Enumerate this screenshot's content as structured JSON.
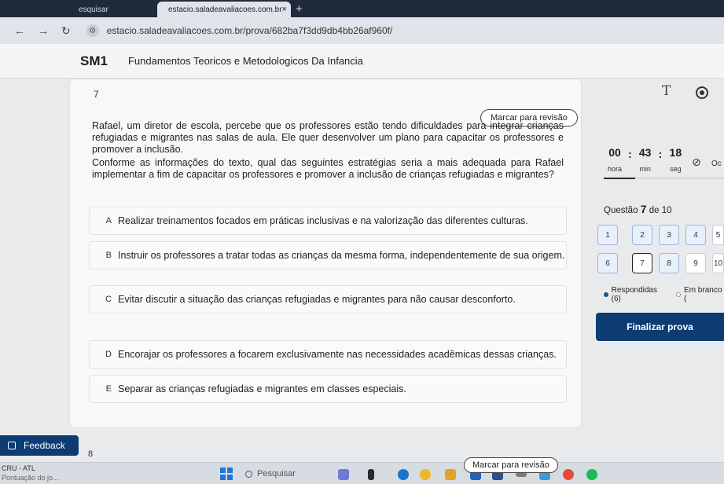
{
  "browser": {
    "tab_prev_label": "esquisar",
    "tab_active_label": "estacio.saladeavaliacoes.com.br",
    "tab_close": "×",
    "new_tab": "+",
    "url": "estacio.saladeavaliacoes.com.br/prova/682ba7f3dd9db4bb26af960f/"
  },
  "header": {
    "logo": "SM1",
    "course_title": "Fundamentos Teoricos e Metodologicos Da Infancia"
  },
  "question": {
    "number": "7",
    "mark_review_label": "Marcar para revisão",
    "stem_paragraphs": [
      "Rafael, um diretor de escola, percebe que os professores estão tendo dificuldades para integrar crianças refugiadas e migrantes nas salas de aula. Ele quer desenvolver um plano para capacitar os professores e promover a inclusão.",
      "Conforme as informações do texto, qual das seguintes estratégias seria a mais adequada para Rafael implementar a fim de capacitar os professores e promover a inclusão de crianças refugiadas e migrantes?"
    ],
    "options": [
      {
        "letter": "A",
        "text": "Realizar treinamentos focados em práticas inclusivas e na valorização das diferentes culturas."
      },
      {
        "letter": "B",
        "text": "Instruir os professores a tratar todas as crianças da mesma forma, independentemente de sua origem."
      },
      {
        "letter": "C",
        "text": "Evitar discutir a situação das crianças refugiadas e migrantes para não causar desconforto."
      },
      {
        "letter": "D",
        "text": "Encorajar os professores a focarem exclusivamente nas necessidades acadêmicas dessas crianças."
      },
      {
        "letter": "E",
        "text": "Separar as crianças refugiadas e migrantes em classes especiais."
      }
    ]
  },
  "timer": {
    "hours": "00",
    "minutes": "43",
    "seconds": "18",
    "hours_label": "hora",
    "minutes_label": "min",
    "seconds_label": "seg",
    "hide_label": "Oc"
  },
  "progress": {
    "question_word": "Questão",
    "current": "7",
    "of_word": "de",
    "total": "10",
    "cells": [
      "1",
      "2",
      "3",
      "4",
      "5",
      "6",
      "7",
      "8",
      "9",
      "10"
    ],
    "answered_legend": "Respondidas (6)",
    "blank_legend": "Em branco (",
    "finish_label": "Finalizar prova"
  },
  "footer": {
    "feedback_label": "Feedback",
    "next_question_number": "8",
    "mark_review_label": "Marcar para revisão"
  },
  "taskbar": {
    "weather_title": "CRU - ATL",
    "weather_sub": "Pontuação do jo...",
    "search_placeholder": "Pesquisar"
  },
  "colors": {
    "primary": "#0d3c73",
    "answered_bg": "#e8f0fb"
  }
}
